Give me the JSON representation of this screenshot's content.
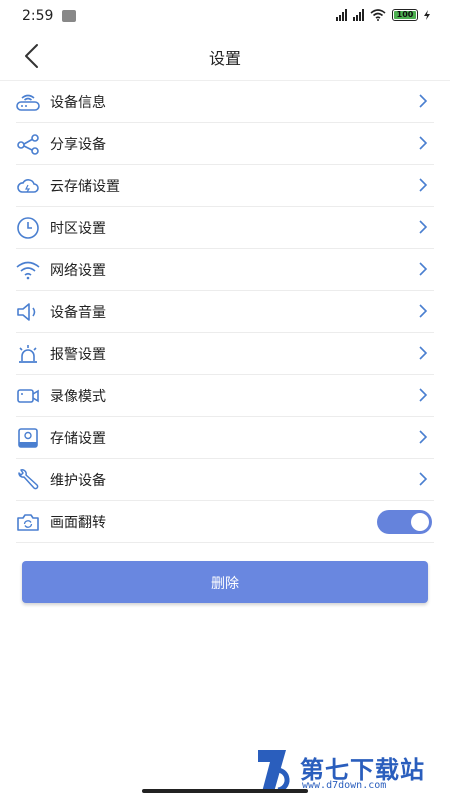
{
  "status_bar": {
    "time": "2:59",
    "battery": "100"
  },
  "header": {
    "title": "设置"
  },
  "menu": [
    {
      "label": "设备信息",
      "icon": "router-icon"
    },
    {
      "label": "分享设备",
      "icon": "share-icon"
    },
    {
      "label": "云存储设置",
      "icon": "cloud-icon"
    },
    {
      "label": "时区设置",
      "icon": "clock-icon"
    },
    {
      "label": "网络设置",
      "icon": "wifi-icon"
    },
    {
      "label": "设备音量",
      "icon": "speaker-icon"
    },
    {
      "label": "报警设置",
      "icon": "alarm-light-icon"
    },
    {
      "label": "录像模式",
      "icon": "video-camera-icon"
    },
    {
      "label": "存储设置",
      "icon": "storage-icon"
    },
    {
      "label": "维护设备",
      "icon": "wrench-icon"
    }
  ],
  "flip": {
    "label": "画面翻转",
    "icon": "camera-flip-icon",
    "enabled": true
  },
  "delete_label": "删除",
  "watermark": {
    "name": "第七下载站",
    "url": "www.d7down.com"
  },
  "colors": {
    "accent": "#6583dc",
    "icon": "#4a7fd0",
    "watermark": "#2a5ebd"
  }
}
